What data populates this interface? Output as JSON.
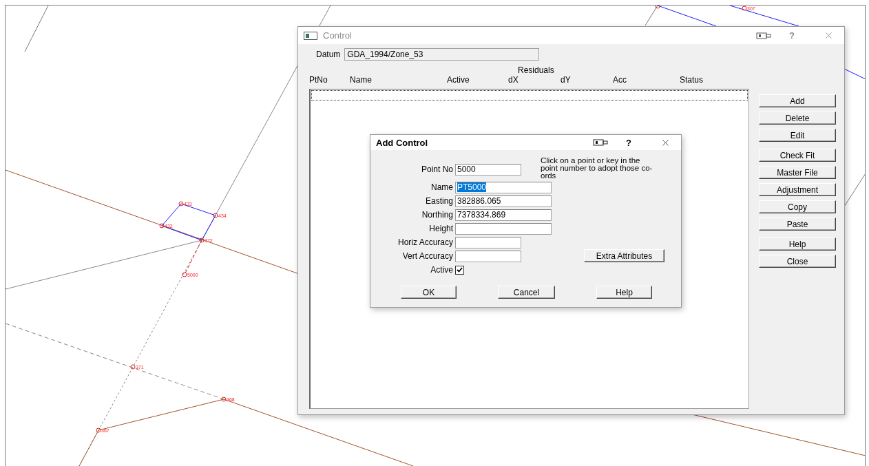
{
  "drawing": {
    "points": [
      {
        "label": "433"
      },
      {
        "label": "434"
      },
      {
        "label": "432"
      },
      {
        "label": "372"
      },
      {
        "label": "5000"
      },
      {
        "label": "371"
      },
      {
        "label": "368"
      },
      {
        "label": "367"
      },
      {
        "label": "307"
      }
    ]
  },
  "control_window": {
    "title": "Control",
    "help": "?",
    "datum_label": "Datum",
    "datum_value": "GDA_1994/Zone_53",
    "residuals_label": "Residuals",
    "columns": [
      "PtNo",
      "Name",
      "Active",
      "dX",
      "dY",
      "Acc",
      "Status"
    ],
    "buttons": [
      "Add",
      "Delete",
      "Edit",
      "Check Fit",
      "Master File",
      "Adjustment",
      "Copy",
      "Paste",
      "Help",
      "Close"
    ]
  },
  "add_control": {
    "title": "Add Control",
    "help": "?",
    "hint": "Click on a point or key in the point number to adopt those co-ords",
    "fields": [
      {
        "label": "Point No",
        "value": "5000",
        "kind": "short",
        "selected": false
      },
      {
        "label": "Name",
        "value": "PT5000",
        "kind": "long",
        "selected": true
      },
      {
        "label": "Easting",
        "value": "382886.065",
        "kind": "long",
        "selected": false
      },
      {
        "label": "Northing",
        "value": "7378334.869",
        "kind": "long",
        "selected": false
      },
      {
        "label": "Height",
        "kind": "long",
        "selected": false
      },
      {
        "label": "Horiz Accuracy",
        "kind": "short",
        "selected": false
      },
      {
        "label": "Vert Accuracy",
        "kind": "short",
        "selected": false
      }
    ],
    "active": {
      "label": "Active",
      "checked": true
    },
    "extra_button": "Extra Attributes",
    "buttons": [
      "OK",
      "Cancel",
      "Help"
    ]
  }
}
